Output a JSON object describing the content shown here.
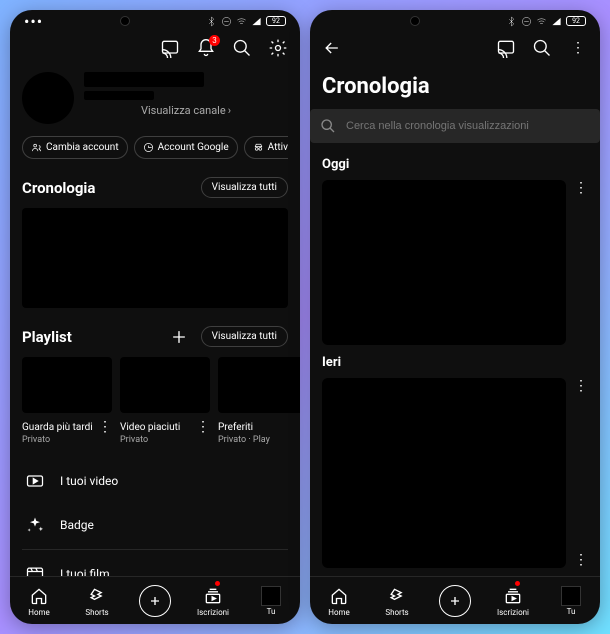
{
  "left": {
    "status": {
      "battery": "92"
    },
    "app_bar": {
      "notif_count": "3"
    },
    "profile": {
      "view_channel": "Visualizza canale"
    },
    "pills": {
      "switch": "Cambia account",
      "google": "Account Google",
      "incognito": "Attiva la navigazione"
    },
    "history": {
      "title": "Cronologia",
      "view_all": "Visualizza tutti"
    },
    "playlist": {
      "title": "Playlist",
      "view_all": "Visualizza tutti",
      "items": [
        {
          "title": "Guarda più tardi",
          "sub": "Privato"
        },
        {
          "title": "Video piaciuti",
          "sub": "Privato"
        },
        {
          "title": "Preferiti",
          "sub": "Privato · Play"
        }
      ]
    },
    "menu": {
      "videos": "I tuoi video",
      "badge": "Badge",
      "movies": "I tuoi film"
    }
  },
  "right": {
    "status": {
      "battery": "92"
    },
    "title": "Cronologia",
    "search_placeholder": "Cerca nella cronologia visualizzazioni",
    "today": "Oggi",
    "yesterday": "Ieri"
  },
  "nav": {
    "home": "Home",
    "shorts": "Shorts",
    "subs": "Iscrizioni",
    "you": "Tu"
  }
}
